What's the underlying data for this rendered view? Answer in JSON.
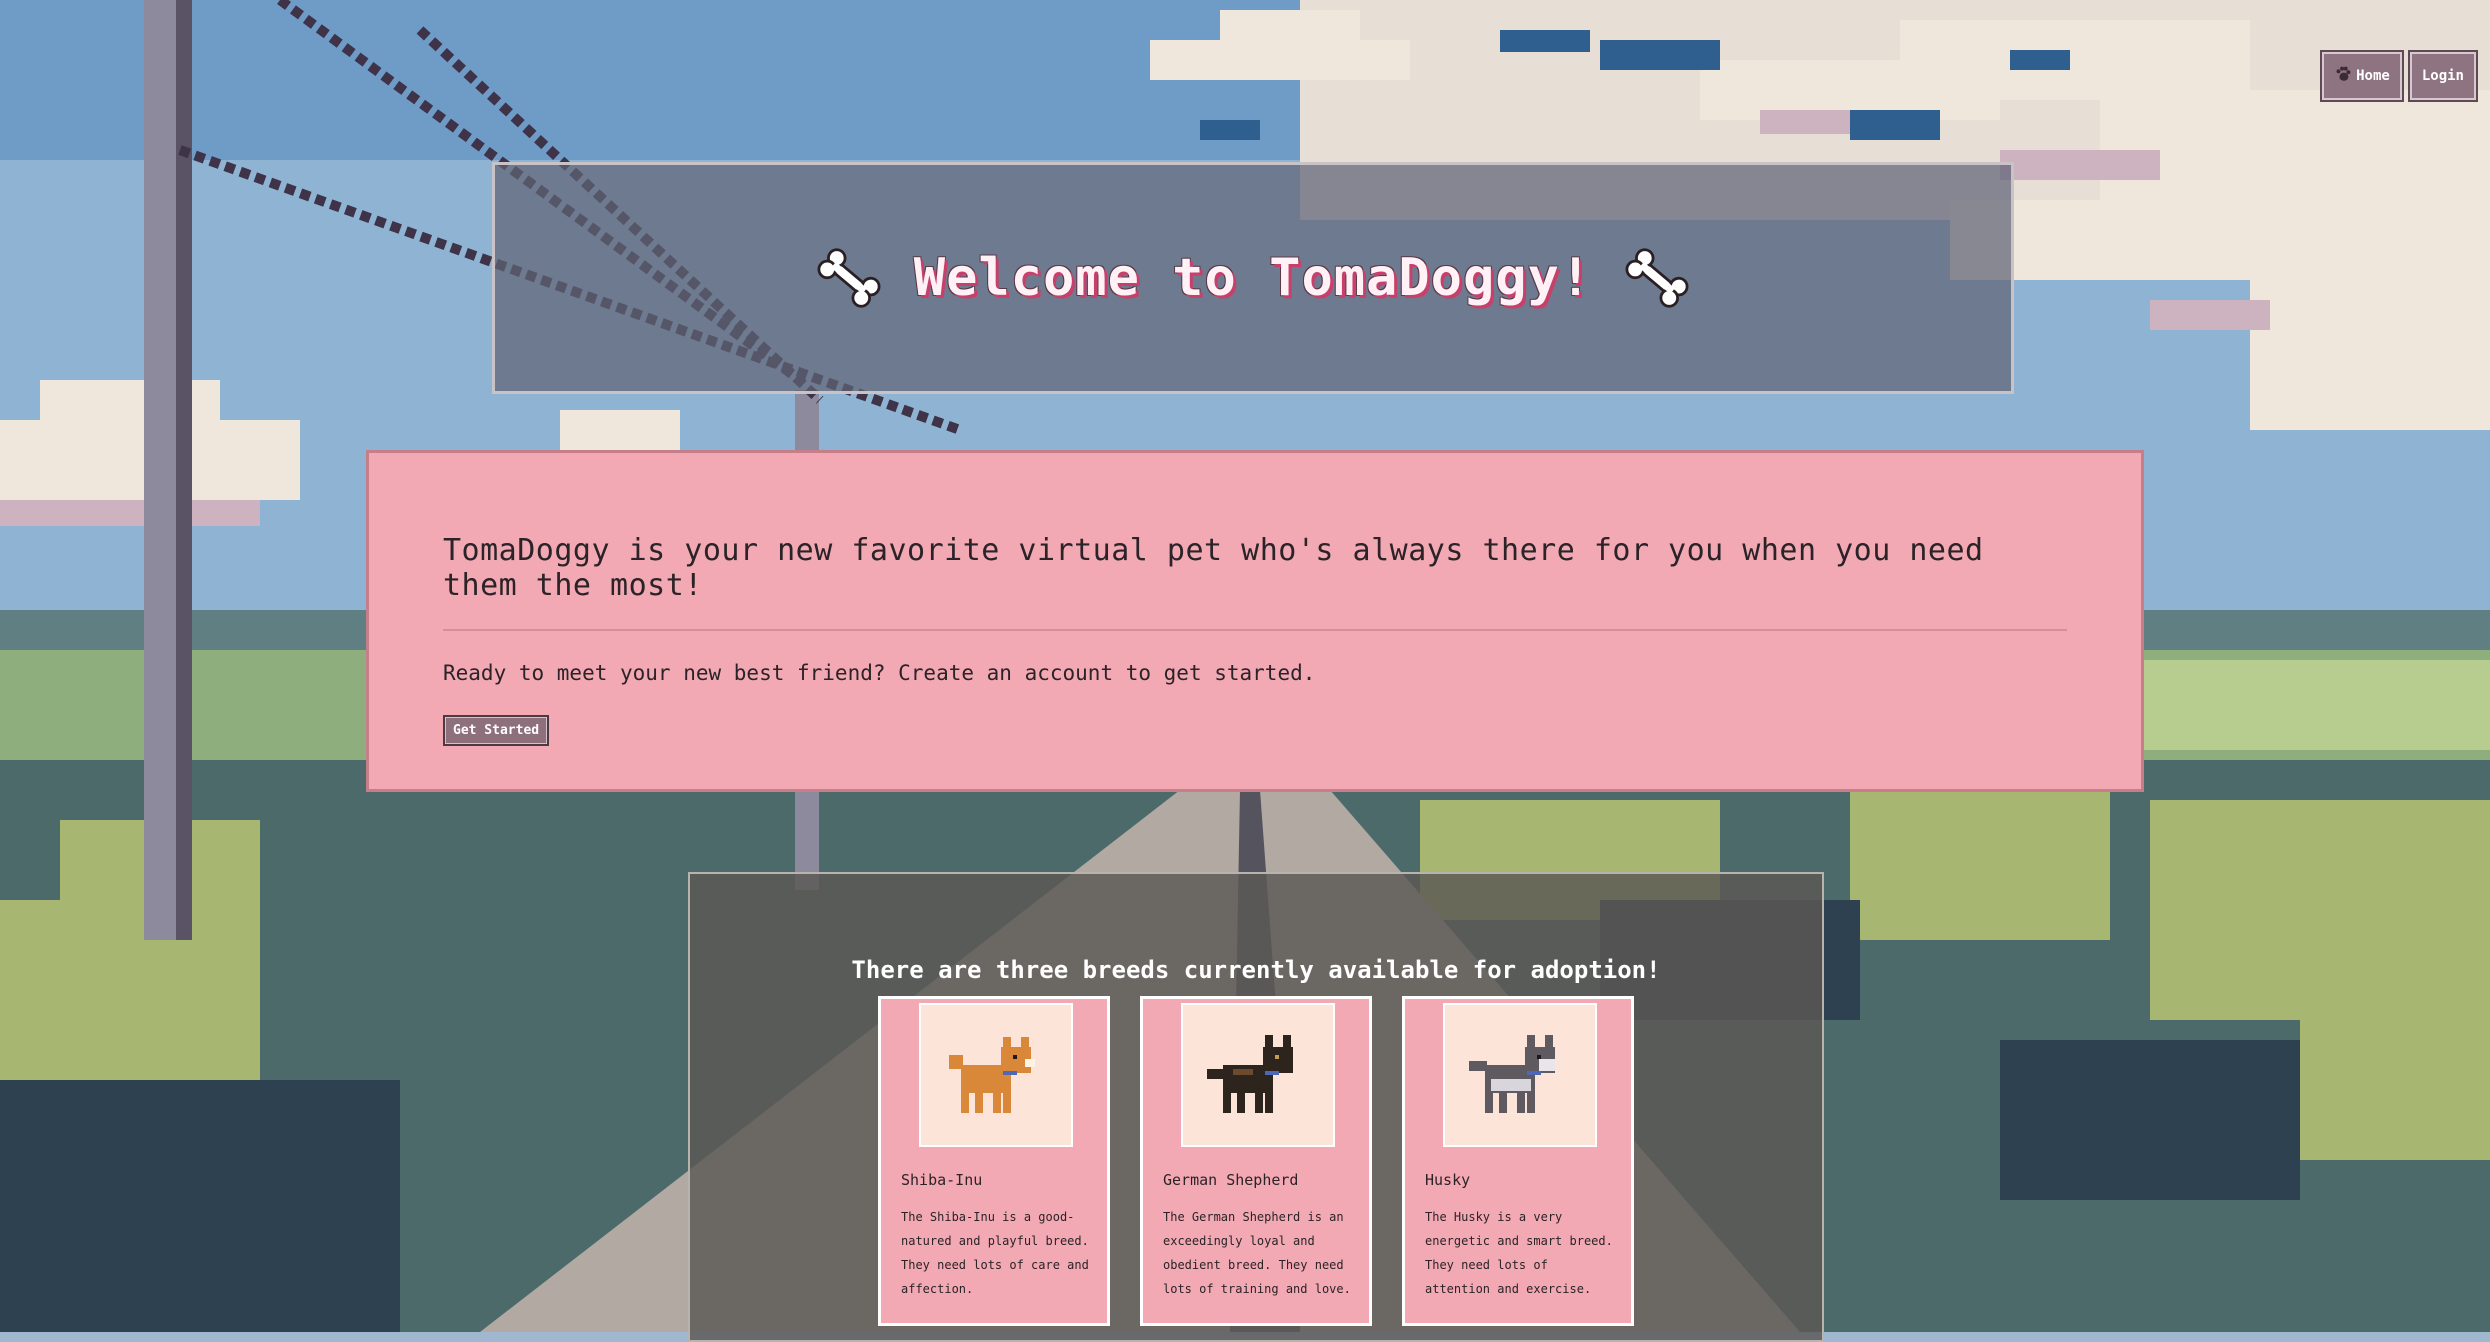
{
  "nav": {
    "home_label": "Home",
    "login_label": "Login"
  },
  "header": {
    "title": "Welcome to TomaDoggy!",
    "icon": "bone-icon"
  },
  "intro": {
    "tagline": "TomaDoggy is your new favorite virtual pet who's always there for you when you need them the most!",
    "cta_text": "Ready to meet your new best friend? Create an account to get started.",
    "button_label": "Get Started"
  },
  "breeds": {
    "heading": "There are three breeds currently available for adoption!",
    "items": [
      {
        "name": "Shiba-Inu",
        "description": "The Shiba-Inu is a good-natured and playful breed. They need lots of care and affection.",
        "color": "#d9883a"
      },
      {
        "name": "German Shepherd",
        "description": "The German Shepherd is an exceedingly loyal and obedient breed. They need lots of training and love.",
        "color": "#2e241e"
      },
      {
        "name": "Husky",
        "description": "The Husky is a very energetic and smart breed. They need lots of attention and exercise.",
        "color": "#5e5a60"
      }
    ]
  },
  "colors": {
    "panel_pink": "#f2a9b4",
    "button_mauve": "#8e6f7c",
    "card_image_bg": "#fde4d8"
  }
}
